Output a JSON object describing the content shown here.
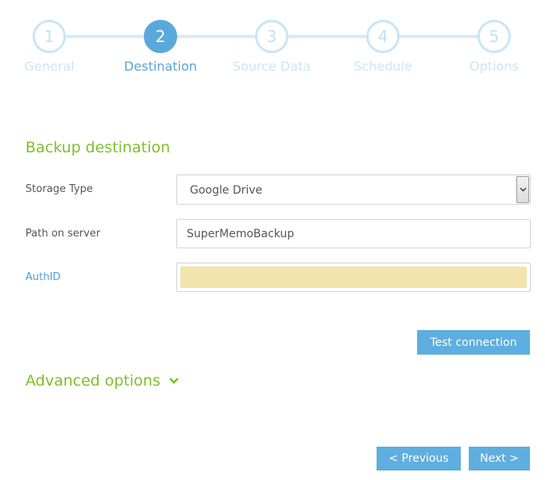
{
  "stepper": {
    "steps": [
      {
        "number": "1",
        "label": "General"
      },
      {
        "number": "2",
        "label": "Destination"
      },
      {
        "number": "3",
        "label": "Source Data"
      },
      {
        "number": "4",
        "label": "Schedule"
      },
      {
        "number": "5",
        "label": "Options"
      }
    ],
    "active_step": 2
  },
  "form": {
    "section_title": "Backup destination",
    "storage_type": {
      "label": "Storage Type",
      "value": "Google Drive"
    },
    "path": {
      "label": "Path on server",
      "value": "SuperMemoBackup"
    },
    "auth": {
      "label": "AuthID",
      "value": ""
    },
    "test_button": "Test connection",
    "advanced_label": "Advanced options"
  },
  "nav": {
    "previous": "< Previous",
    "next": "Next >"
  },
  "colors": {
    "accent_blue": "#5eaedf",
    "accent_green": "#7ebf2b",
    "auth_fill": "#f2e4aa"
  },
  "icons": {
    "select_arrow": "chevron-down-icon",
    "advanced_toggle": "chevron-down-icon"
  }
}
